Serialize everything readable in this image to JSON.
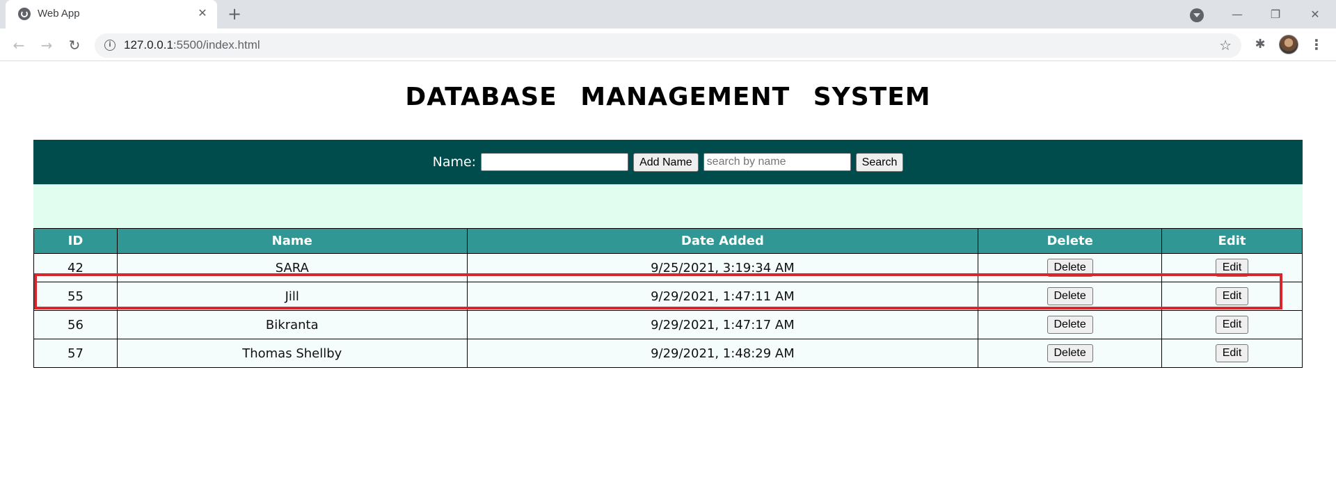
{
  "browser": {
    "tab_title": "Web App",
    "tab_close": "✕",
    "new_tab": "+",
    "url_host": "127.0.0.1",
    "url_path": ":5500/index.html",
    "icons": [
      "globe-icon",
      "close-icon",
      "plus-icon",
      "tab-search-icon",
      "minimize-icon",
      "restore-icon",
      "window-close-icon",
      "back-icon",
      "forward-icon",
      "reload-icon",
      "info-icon",
      "star-icon",
      "puzzle-icon",
      "avatar",
      "kebab-menu-icon"
    ]
  },
  "page": {
    "title": "DATABASE MANAGEMENT SYSTEM"
  },
  "form": {
    "name_label": "Name:",
    "name_value": "",
    "add_button": "Add Name",
    "search_placeholder": "search by name",
    "search_button": "Search"
  },
  "table": {
    "headers": [
      "ID",
      "Name",
      "Date Added",
      "Delete",
      "Edit"
    ],
    "delete_label": "Delete",
    "edit_label": "Edit",
    "rows": [
      {
        "id": "42",
        "name": "SARA",
        "date": "9/25/2021, 3:19:34 AM"
      },
      {
        "id": "55",
        "name": "Jill",
        "date": "9/29/2021, 1:47:11 AM"
      },
      {
        "id": "56",
        "name": "Bikranta",
        "date": "9/29/2021, 1:47:17 AM"
      },
      {
        "id": "57",
        "name": "Thomas Shellby",
        "date": "9/29/2021, 1:48:29 AM"
      }
    ]
  },
  "colors": {
    "form_bar": "#004b4b",
    "mint_band": "#e1fdf0",
    "table_header": "#319795",
    "highlight": "#d9262b"
  }
}
